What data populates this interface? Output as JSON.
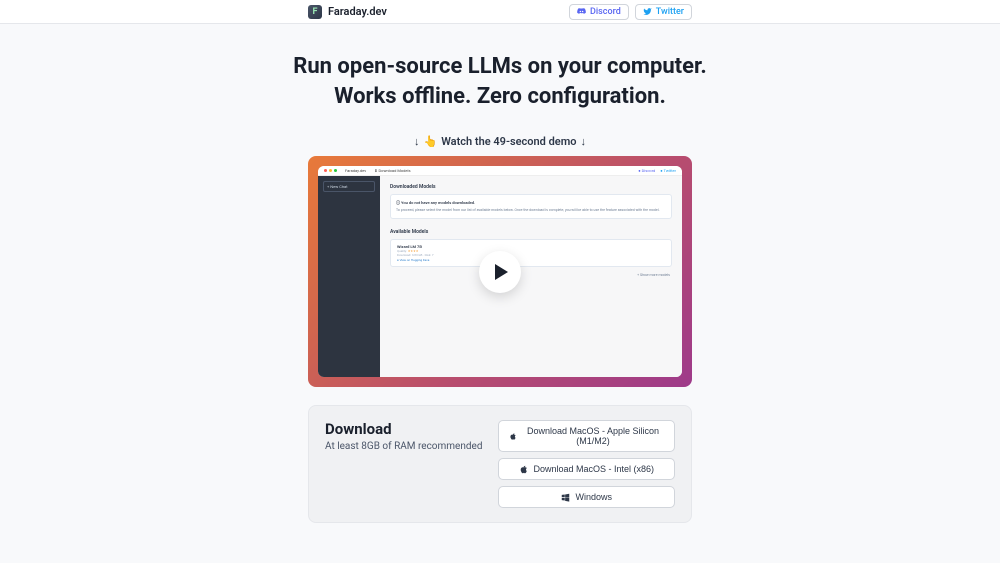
{
  "header": {
    "brand": "Faraday.dev",
    "discord": "Discord",
    "twitter": "Twitter"
  },
  "hero": {
    "line1": "Run open-source LLMs on your computer.",
    "line2": "Works offline. Zero configuration.",
    "watch_demo": "Watch the 49-second demo"
  },
  "app_preview": {
    "title": "Faraday.dev",
    "tab": "Download Models",
    "discord": "Discord",
    "twitter": "Twitter",
    "new_chat": "+ New Chat",
    "downloaded_heading": "Downloaded Models",
    "empty_title": "You do not have any models downloaded.",
    "empty_body": "To proceed, please select the model from our list of available models below. Once the download is complete, you will be able to use the feature associated with the model.",
    "available_heading": "Available Models",
    "model_name": "Wizard LM 7B",
    "model_quality": "Quality:",
    "model_size": "Download: 3.83 GB · Disk: 7",
    "view_hugging": "View on Hugging Face",
    "show_more": "+ Show more models"
  },
  "download": {
    "title": "Download",
    "subtitle": "At least 8GB of RAM recommended",
    "btn_silicon": "Download MacOS - Apple Silicon (M1/M2)",
    "btn_intel": "Download MacOS - Intel (x86)",
    "btn_windows": "Windows"
  }
}
